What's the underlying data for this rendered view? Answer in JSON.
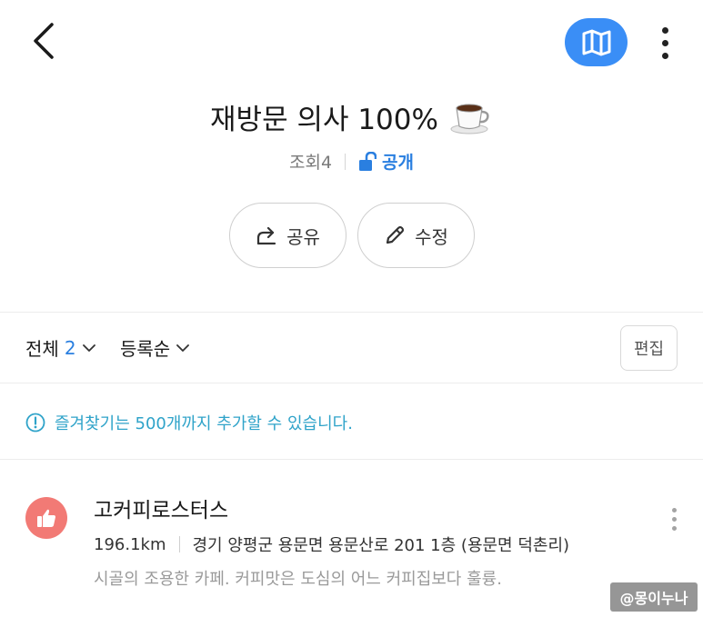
{
  "header": {
    "back_icon": "chevron-left-icon",
    "map_icon": "map-icon",
    "more_icon": "more-vertical-icon",
    "accent_color": "#3a8ef6"
  },
  "list": {
    "title": "재방문 의사 100%",
    "title_emoji": "coffee-cup-icon",
    "views": "조회4",
    "visibility": "공개",
    "visibility_color": "#2a7fe0"
  },
  "actions": {
    "share_label": "공유",
    "edit_label": "수정"
  },
  "filter": {
    "all_label": "전체",
    "all_count": "2",
    "sort_label": "등록순",
    "edit_button": "편집"
  },
  "notice": {
    "text": "즐겨찾기는 500개까지 추가할 수 있습니다.",
    "color": "#2fa3c9"
  },
  "places": [
    {
      "name": "고커피로스터스",
      "distance": "196.1km",
      "address": "경기 양평군 용문면 용문산로 201 1층 (용문면 덕촌리)",
      "memo": "시골의 조용한 카페. 커피맛은 도심의 어느 커피집보다 훌륭.",
      "badge_icon": "thumbs-up-icon",
      "badge_color": "#f27a75"
    }
  ],
  "watermark": "@몽이누나"
}
